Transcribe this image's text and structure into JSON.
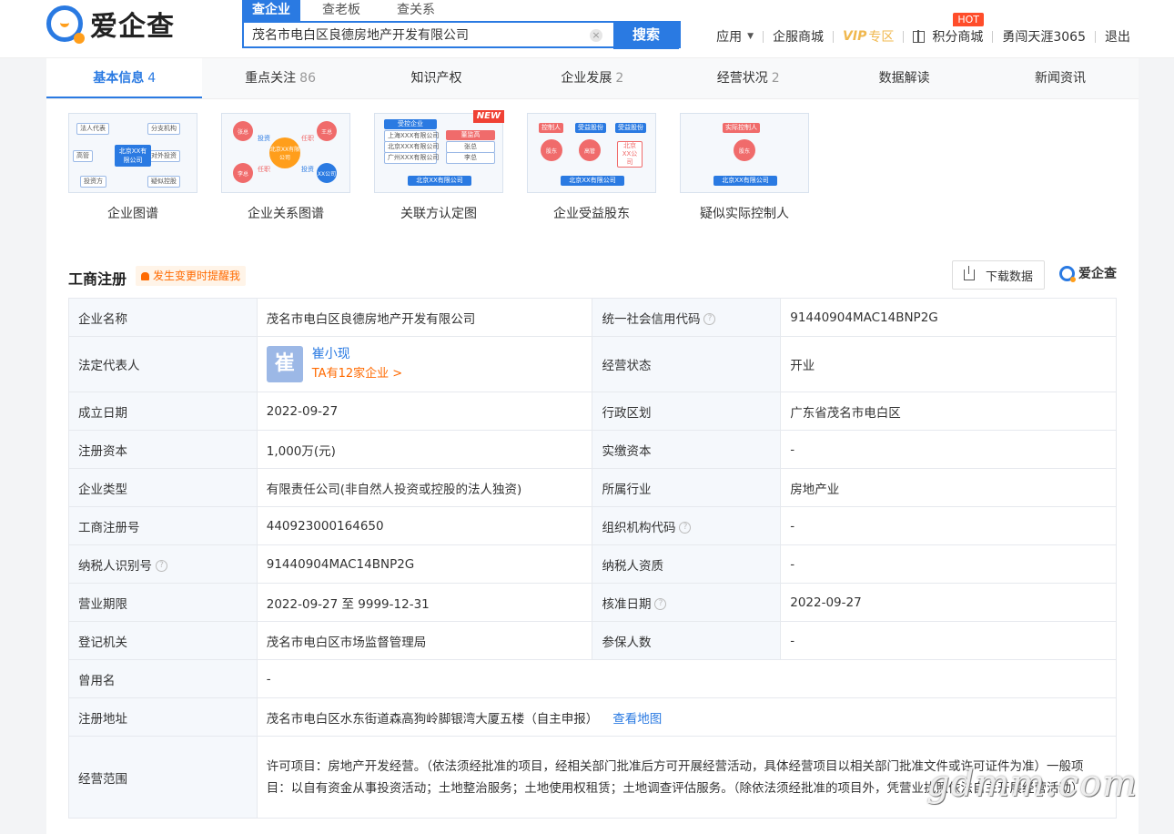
{
  "header": {
    "logo_text": "爱企查",
    "search_tabs": [
      "查企业",
      "查老板",
      "查关系"
    ],
    "search_value": "茂名市电白区良德房地产开发有限公司",
    "search_button": "搜索",
    "clear_icon": "×",
    "nav": {
      "apps": "应用",
      "mall": "企服商城",
      "vip": "VIP",
      "vip_zone": "专区",
      "points": "积分商城",
      "hot": "HOT",
      "user": "勇闯天涯3065",
      "logout": "退出"
    }
  },
  "tabs": [
    {
      "label": "基本信息",
      "count": "4"
    },
    {
      "label": "重点关注",
      "count": "86"
    },
    {
      "label": "知识产权",
      "count": ""
    },
    {
      "label": "企业发展",
      "count": "2"
    },
    {
      "label": "经营状况",
      "count": "2"
    },
    {
      "label": "数据解读",
      "count": ""
    },
    {
      "label": "新闻资讯",
      "count": ""
    }
  ],
  "graphs": {
    "items": [
      "企业图谱",
      "企业关系图谱",
      "关联方认定图",
      "企业受益股东",
      "疑似实际控制人"
    ],
    "new_badge": "NEW",
    "g1": {
      "center": "北京XX有限公司",
      "nodes": [
        "法人代表",
        "分支机构",
        "高管",
        "对外投资",
        "投资方",
        "疑似控股"
      ]
    },
    "g2": {
      "center": "北京XX有限公司",
      "nodes": [
        "张总",
        "王总",
        "李总",
        "XX公司"
      ],
      "links": [
        "投资",
        "任职",
        "任职",
        "投资"
      ]
    },
    "g3": {
      "left_header": "受控企业",
      "left_rows": [
        "上海XXX有限公司",
        "北京XXX有限公司",
        "广州XXX有限公司"
      ],
      "right_header": "董监高",
      "right_rows": [
        "张总",
        "李总"
      ],
      "bottom": "北京XX有限公司"
    },
    "g4": {
      "tags": [
        "控制人",
        "受益股份",
        "受益股份"
      ],
      "nodes": [
        "股东",
        "高管",
        "北京XX公司"
      ],
      "bottom": "北京XX有限公司"
    },
    "g5": {
      "tag": "实际控制人",
      "node": "股东",
      "bottom": "北京XX有限公司"
    }
  },
  "section": {
    "title": "工商注册",
    "remind": "发生变更时提醒我",
    "download": "下载数据",
    "brand": "爱企查"
  },
  "info": {
    "name_label": "企业名称",
    "name": "茂名市电白区良德房地产开发有限公司",
    "credit_label": "统一社会信用代码",
    "credit": "91440904MAC14BNP2G",
    "legal_label": "法定代表人",
    "legal_avatar": "崔",
    "legal_name": "崔小现",
    "legal_link": "TA有12家企业 >",
    "status_label": "经营状态",
    "status": "开业",
    "found_label": "成立日期",
    "found": "2022-09-27",
    "region_label": "行政区划",
    "region": "广东省茂名市电白区",
    "capital_label": "注册资本",
    "capital": "1,000万(元)",
    "paid_label": "实缴资本",
    "paid": "-",
    "type_label": "企业类型",
    "type": "有限责任公司(非自然人投资或控股的法人独资)",
    "industry_label": "所属行业",
    "industry": "房地产业",
    "regno_label": "工商注册号",
    "regno": "440923000164650",
    "orgcode_label": "组织机构代码",
    "orgcode": "-",
    "taxid_label": "纳税人识别号",
    "taxid": "91440904MAC14BNP2G",
    "taxqual_label": "纳税人资质",
    "taxqual": "-",
    "term_label": "营业期限",
    "term": "2022-09-27 至 9999-12-31",
    "approve_label": "核准日期",
    "approve": "2022-09-27",
    "authority_label": "登记机关",
    "authority": "茂名市电白区市场监督管理局",
    "insured_label": "参保人数",
    "insured": "-",
    "former_label": "曾用名",
    "former": "-",
    "address_label": "注册地址",
    "address": "茂名市电白区水东街道森高狗岭脚银湾大厦五楼（自主申报）",
    "map_link": "查看地图",
    "scope_label": "经营范围",
    "scope": "许可项目：房地产开发经营。（依法须经批准的项目，经相关部门批准后方可开展经营活动，具体经营项目以相关部门批准文件或许可证件为准）一般项目：以自有资金从事投资活动；土地整治服务；土地使用权租赁；土地调查评估服务。（除依法须经批准的项目外，凭营业执照依法自主开展经营活动）",
    "help_icon": "?"
  },
  "watermark": "gdmm.com"
}
